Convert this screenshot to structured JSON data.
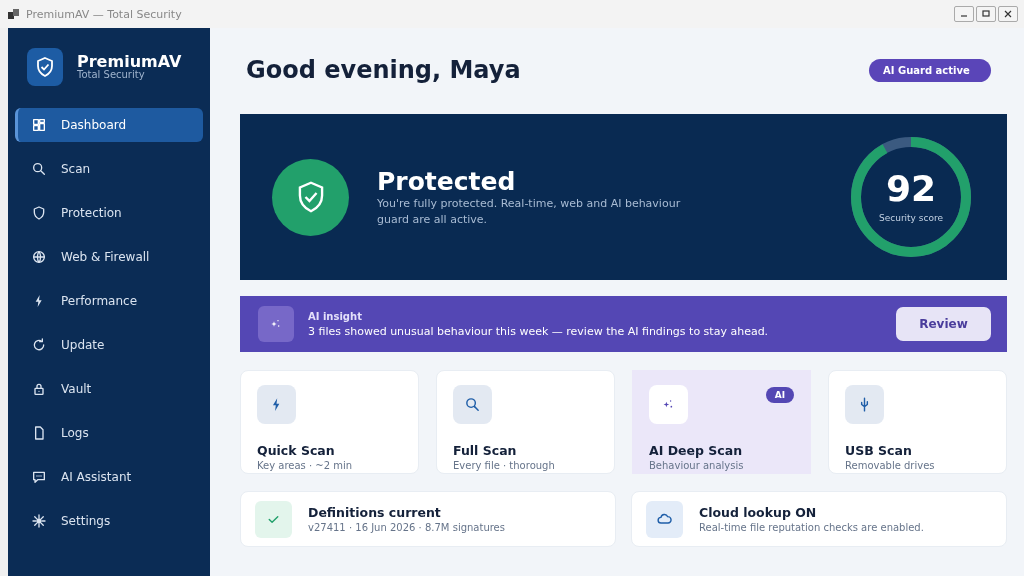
{
  "window": {
    "title": "PremiumAV — Total Security"
  },
  "brand": {
    "name": "PremiumAV",
    "tagline": "Total Security"
  },
  "sidebar": {
    "items": [
      {
        "label": "Dashboard",
        "selected": true
      },
      {
        "label": "Scan",
        "selected": false
      },
      {
        "label": "Protection",
        "selected": false
      },
      {
        "label": "Web & Firewall",
        "selected": false
      },
      {
        "label": "Performance",
        "selected": false
      },
      {
        "label": "Update",
        "selected": false
      },
      {
        "label": "Vault",
        "selected": false
      },
      {
        "label": "Logs",
        "selected": false
      },
      {
        "label": "AI Assistant",
        "selected": false
      },
      {
        "label": "Settings",
        "selected": false
      }
    ]
  },
  "greeting": "Good evening, Maya",
  "status_badge": "AI Guard active",
  "status": {
    "title": "Protected",
    "message": "You're fully protected. Real-time, web and AI behaviour guard are all active.",
    "score": "92",
    "score_label": "Security score",
    "level": 0.92
  },
  "insight": {
    "title": "AI insight",
    "message": "3 files showed unusual behaviour this week — review the AI findings to stay ahead.",
    "button": "Review"
  },
  "scans": [
    {
      "title": "Quick Scan",
      "subtitle": "Key areas · ~2 min",
      "selected": false
    },
    {
      "title": "Full Scan",
      "subtitle": "Every file · thorough",
      "selected": false
    },
    {
      "title": "AI Deep Scan",
      "subtitle": "Behaviour analysis",
      "selected": true,
      "badge": "AI"
    },
    {
      "title": "USB Scan",
      "subtitle": "Removable drives",
      "selected": false
    }
  ],
  "info_cards": [
    {
      "title": "Definitions current",
      "subtitle": "v27411 · 16 Jun 2026 · 8.7M signatures"
    },
    {
      "title": "Cloud lookup  ON",
      "subtitle": "Real-time file reputation checks are enabled."
    }
  ]
}
